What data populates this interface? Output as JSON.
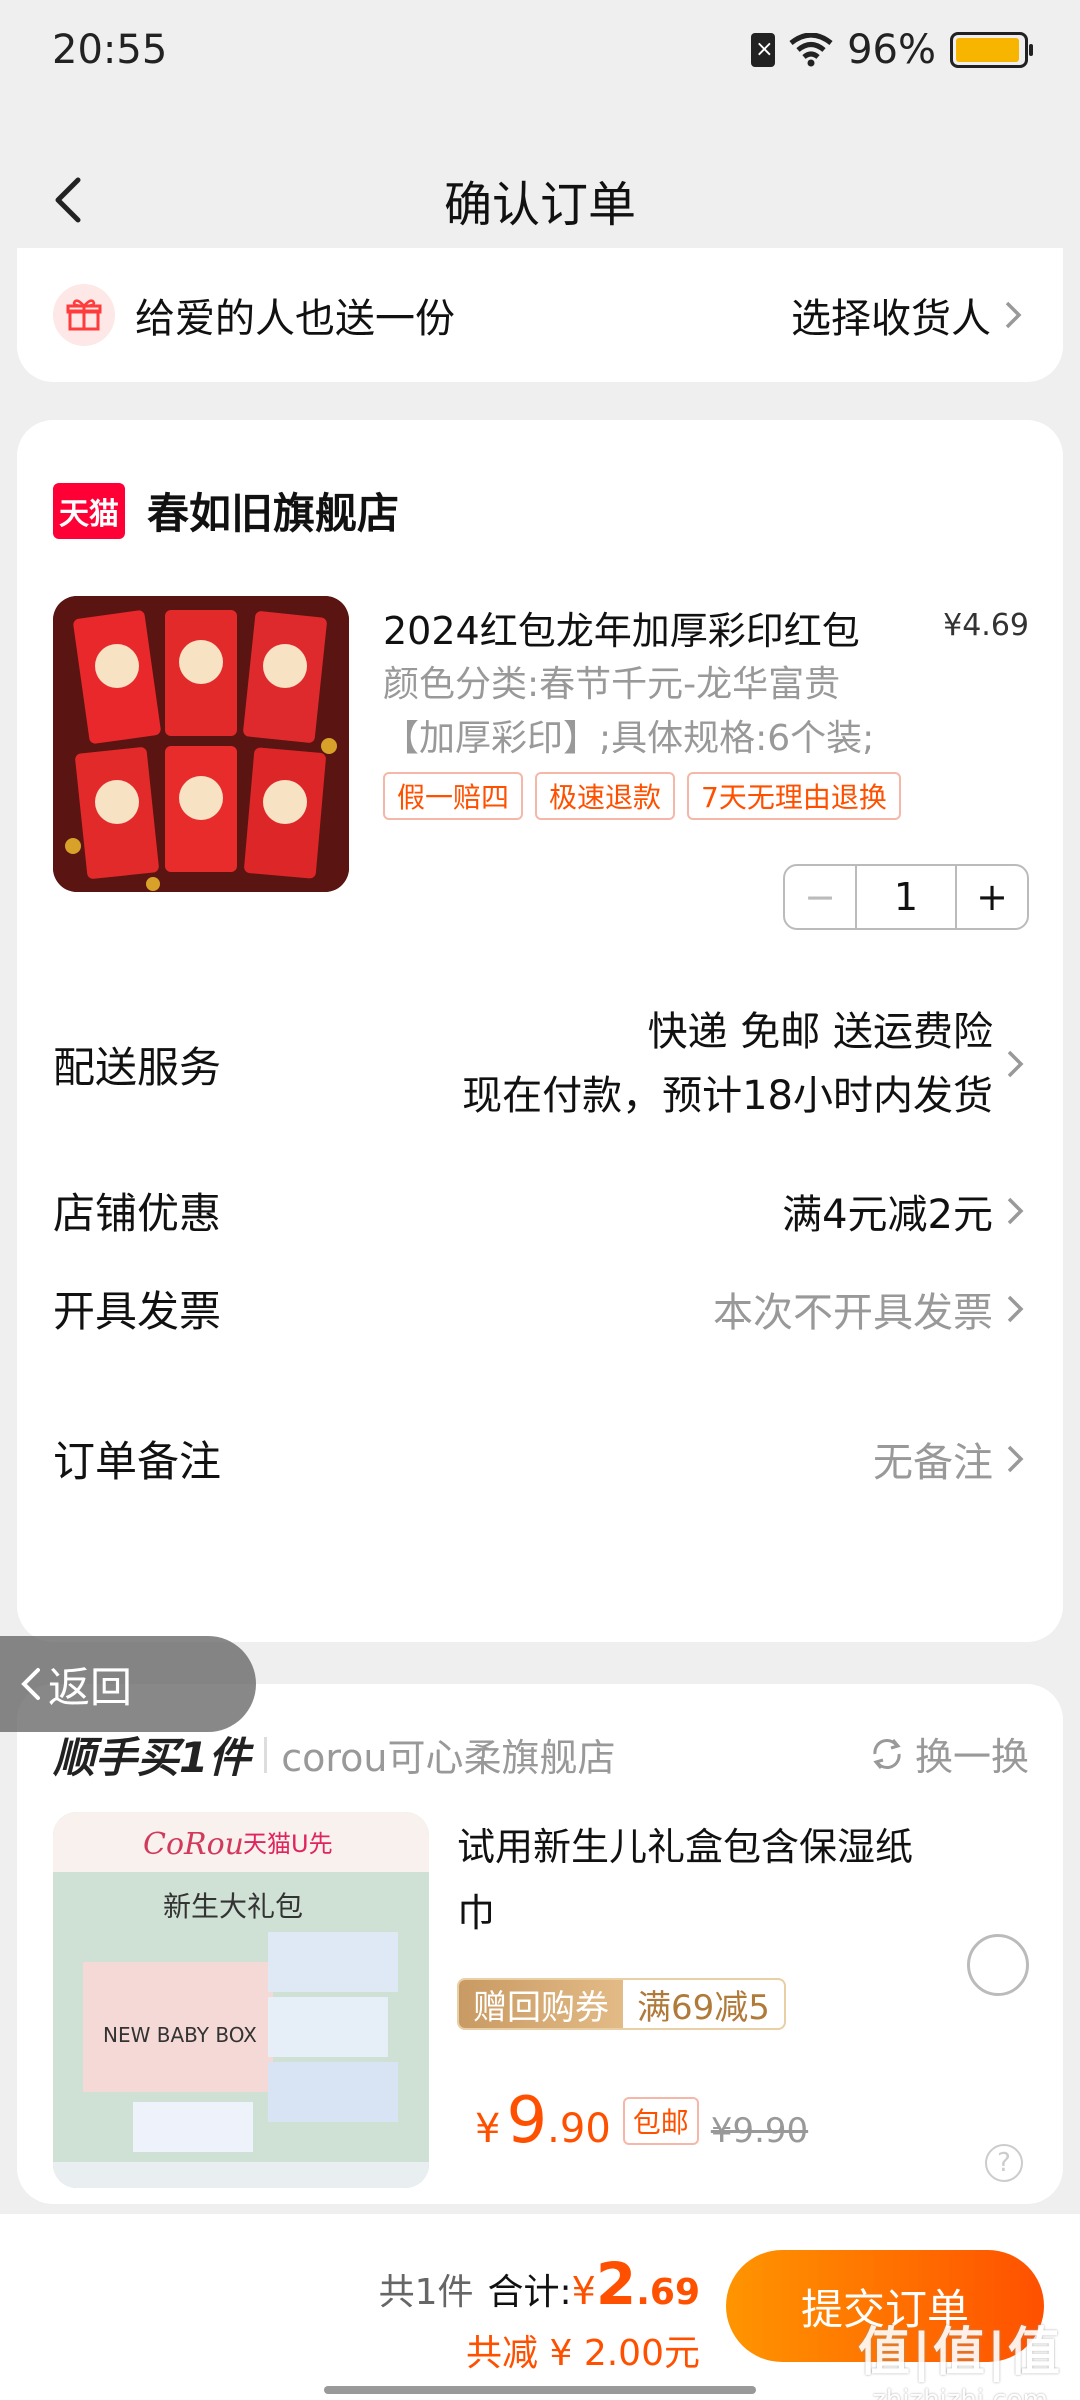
{
  "status_bar": {
    "time": "20:55",
    "battery": "96%",
    "battery_level": 0.96
  },
  "nav": {
    "title": "确认订单"
  },
  "gift": {
    "text": "给爱的人也送一份",
    "action": "选择收货人"
  },
  "shop": {
    "logo_text": "天猫",
    "name": "春如旧旗舰店"
  },
  "product": {
    "title": "2024红包龙年加厚彩印红包",
    "price": "¥4.69",
    "spec_line1": "颜色分类:春节千元-龙华富贵",
    "spec_line2": "【加厚彩印】;具体规格:6个装;",
    "tags": [
      "假一赔四",
      "极速退款",
      "7天无理由退换"
    ],
    "quantity": "1",
    "minus": "−",
    "plus": "+"
  },
  "delivery": {
    "label": "配送服务",
    "line1": "快递 免邮 送运费险",
    "line2": "现在付款，预计18小时内发货"
  },
  "discount": {
    "label": "店铺优惠",
    "value": "满4元减2元"
  },
  "invoice": {
    "label": "开具发票",
    "value": "本次不开具发票"
  },
  "note": {
    "label": "订单备注",
    "value": "无备注"
  },
  "float_back": {
    "label": "返回"
  },
  "recommend": {
    "title": "顺手买1件",
    "shop": "corou可心柔旗舰店",
    "swap": "换一换",
    "name": "试用新生儿礼盒包含保湿纸巾",
    "coupon_left": "赠回购券",
    "coupon_right": "满69减5",
    "price_symbol": "¥",
    "price_int": "9",
    "price_dec": ".90",
    "free_shipping": "包邮",
    "old_price": "¥9.90",
    "help": "?",
    "img_brand": "CoRou",
    "img_tag": "天猫U先",
    "img_caption": "新生大礼包",
    "img_box": "NEW BABY BOX"
  },
  "bottom": {
    "count": "共1件",
    "total_label": "合计:",
    "total_symbol": "¥",
    "total_int": "2",
    "total_dec": ".69",
    "saved": "共减 ¥ 2.00元",
    "submit": "提交订单"
  },
  "watermark": {
    "big": "值|值|值",
    "small": "zhizhizhi.com"
  },
  "colors": {
    "accent": "#ff5000",
    "tmall_red": "#ff0036",
    "coupon_gold": "#c99a63"
  }
}
